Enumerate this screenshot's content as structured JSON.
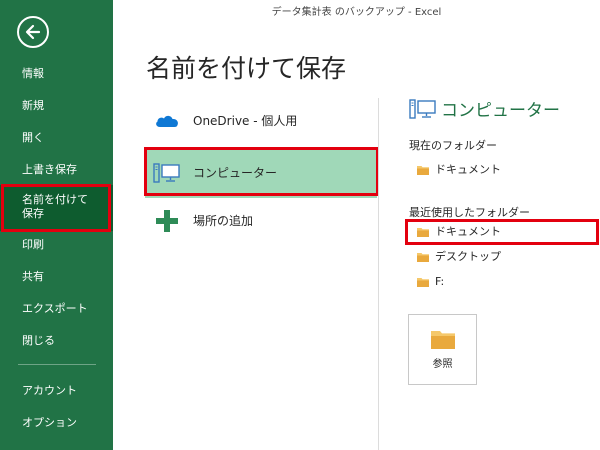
{
  "window": {
    "title": "データ集計表 のバックアップ - Excel"
  },
  "nav": {
    "items": [
      {
        "label": "情報"
      },
      {
        "label": "新規"
      },
      {
        "label": "開く"
      },
      {
        "label": "上書き保存"
      },
      {
        "label": "名前を付けて\n保存"
      },
      {
        "label": "印刷"
      },
      {
        "label": "共有"
      },
      {
        "label": "エクスポート"
      },
      {
        "label": "閉じる"
      },
      {
        "label": "アカウント"
      },
      {
        "label": "オプション"
      }
    ],
    "selected_index": 4
  },
  "page": {
    "title": "名前を付けて保存"
  },
  "places": [
    {
      "label": "OneDrive - 個人用",
      "icon": "cloud-icon"
    },
    {
      "label": "コンピューター",
      "icon": "computer-icon"
    },
    {
      "label": "場所の追加",
      "icon": "plus-icon"
    }
  ],
  "detail": {
    "title": "コンピューター",
    "current_folder_label": "現在のフォルダー",
    "current_folder": "ドキュメント",
    "recent_label": "最近使用したフォルダー",
    "recent_folders": [
      "ドキュメント",
      "デスクトップ",
      "F:"
    ],
    "browse_label": "参照"
  },
  "colors": {
    "nav_bg": "#217346",
    "nav_selected": "#0e5c2f",
    "place_selected": "#a0d8b8",
    "highlight_red": "#e3000f",
    "accent_green": "#217346",
    "folder_yellow": "#f5c86a"
  }
}
